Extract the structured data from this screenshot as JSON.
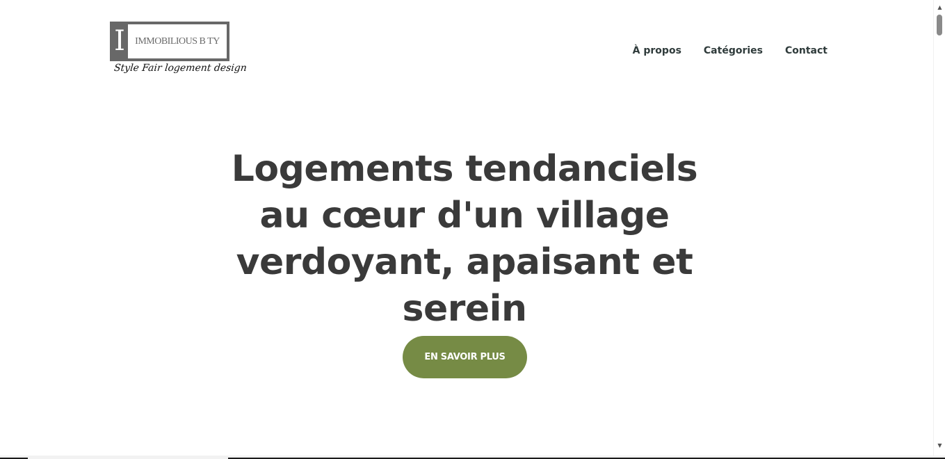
{
  "header": {
    "logo": {
      "initial": "I",
      "name": "IMMOBILIOUS B TY",
      "tagline": "Style Fair logement design"
    },
    "nav": [
      {
        "label": "À propos"
      },
      {
        "label": "Catégories"
      },
      {
        "label": "Contact"
      }
    ]
  },
  "hero": {
    "title": "Logements tendanciels au cœur d'un village verdoyant, apaisant et serein",
    "cta_label": "EN SAVOIR PLUS"
  },
  "colors": {
    "accent": "#768b45",
    "text": "#3a3a3a",
    "nav_text": "#2f3b3b",
    "logo_gray": "#686868"
  },
  "icons": {
    "scroll_up": "chevron-up-icon",
    "scroll_down": "chevron-down-icon"
  }
}
